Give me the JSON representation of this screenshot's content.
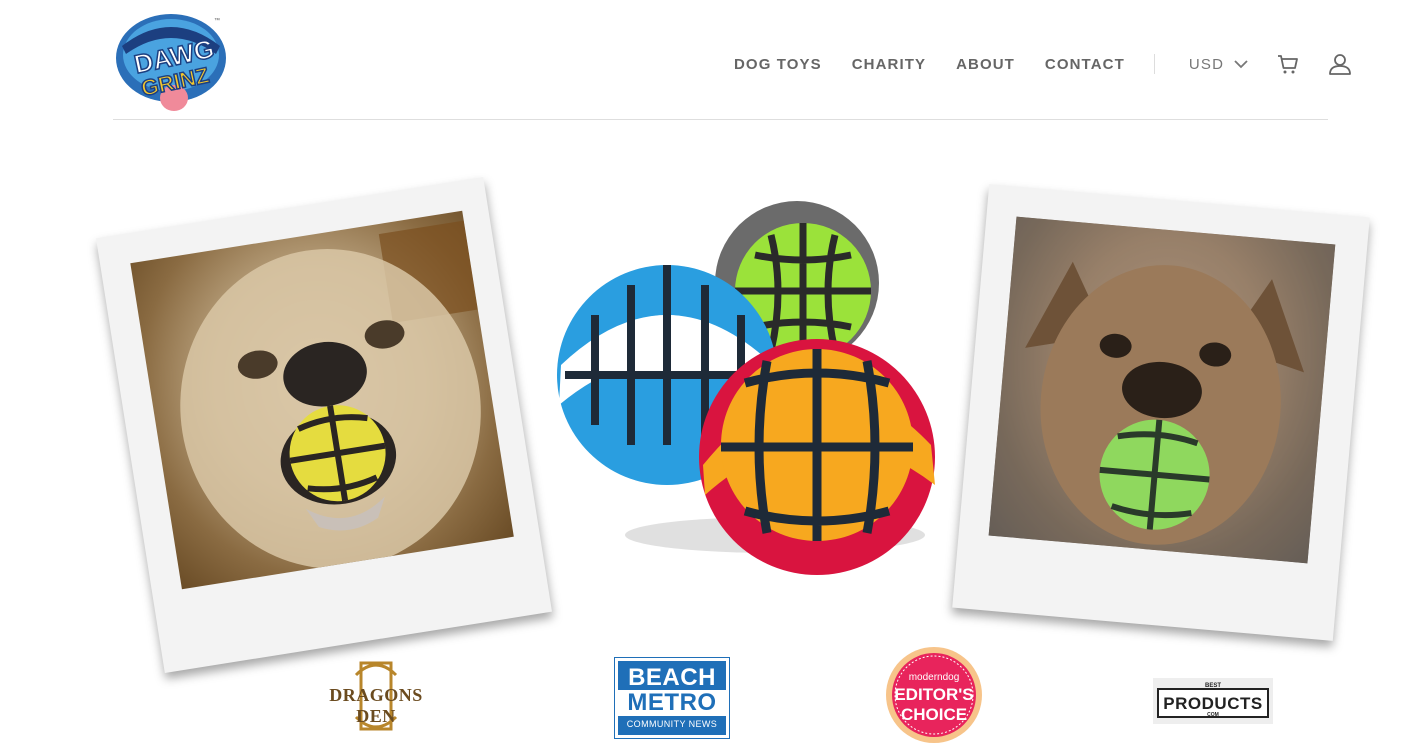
{
  "brand": {
    "logo_line1": "DAWG",
    "logo_line2": "GRINZ",
    "logo_tm": "™"
  },
  "nav": {
    "items": [
      {
        "label": "DOG TOYS"
      },
      {
        "label": "CHARITY"
      },
      {
        "label": "ABOUT"
      },
      {
        "label": "CONTACT"
      }
    ],
    "currency": "USD",
    "cart_icon": "cart-icon",
    "account_icon": "user-icon"
  },
  "press": {
    "dragons_den": "DRAGONS DEN",
    "beach_metro": {
      "line1": "BEACH",
      "line2": "METRO",
      "line3": "COMMUNITY NEWS"
    },
    "modern_dog": {
      "brand": "moderndog",
      "line1": "EDITOR'S",
      "line2": "CHOICE"
    },
    "best_products": {
      "top": "BEST",
      "main": "PRODUCTS",
      "bottom": "COM"
    }
  },
  "colors": {
    "nav_text": "#666666",
    "rule": "#dedede",
    "beach_blue": "#1f6fb8",
    "modern_pink": "#e8245c",
    "ball_yellow": "#f7a81f",
    "ball_green": "#9be23a",
    "ball_blue": "#2a9ee0",
    "ball_red": "#d9143f"
  }
}
